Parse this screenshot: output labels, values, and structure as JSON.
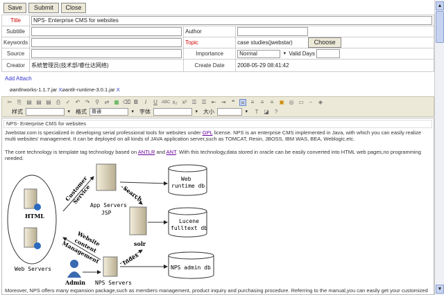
{
  "toolbar": {
    "save": "Save",
    "submit": "Submit",
    "close": "Close"
  },
  "form": {
    "title_label": "Title",
    "title_value": "NPS- Enterprise CMS for websites",
    "subtitle_label": "Subtitle",
    "subtitle_value": "",
    "author_label": "Author",
    "author_value": "",
    "keywords_label": "Keywords",
    "keywords_value": "",
    "topic_label": "Topic",
    "topic_value": "case studies(jwebstar)",
    "choose": "Choose",
    "source_label": "Source",
    "source_value": "",
    "importance_label": "Importance",
    "importance_value": "Normal",
    "valid_days_label": "Valid Days",
    "valid_days_value": "",
    "creator_label": "Creator",
    "creator_value": "系統管理员(技术部/睿仕达网络)",
    "create_date_label": "Create Date",
    "create_date_value": "2008-05-29 08:41:42"
  },
  "attach": {
    "add": "Add Attach",
    "files": [
      {
        "name": "antlrworks-1.1.7.jar",
        "remove": "X"
      },
      {
        "name": "antlr-runtime-3.0.1.jar",
        "remove": "X"
      }
    ]
  },
  "editor_toolbar": {
    "style_label": "样式",
    "style_value": "",
    "format_label": "格式",
    "format_value": "普通",
    "font_label": "字体",
    "font_value": "",
    "size_label": "大小",
    "size_value": ""
  },
  "content": {
    "heading": "NPS- Enterprise CMS for websites",
    "p1a": "Jwebstar.com is specialized in developing serial professional tools for websites under ",
    "gpl": "GPL",
    "p1b": " license. NPS is an enterprise CMS implemented in Java, with which you can easily realize multi websites' management. It can be deployed on all kinds of JAVA application server,such as TOMCAT, Resin, JBOSS, IBM WAS, BEA, Weblogic,etc.",
    "p2a": "The core technology is template tag technology based on ",
    "antlr": "ANTLR",
    "and": " and ",
    "ant": "ANT",
    "p2b": ". With this technology,data stored in oracle can be easily converted into HTML web pages,no programming needed.",
    "p3": "Moreover, NPS offers many expansion package,such as members management, product inquiry and purchasing procedure. Referring to the manual,you can easily get your customized",
    "diagram": {
      "html": "HTML",
      "web_servers": "Web Servers",
      "customer": "Customer",
      "service": "Service",
      "app_servers": "App Servers",
      "jsp": "JSP",
      "search": "Search",
      "solr": "solr",
      "website": "Website",
      "content": "content",
      "management": "Management",
      "index": "Index",
      "admin": "Admin",
      "nps_servers": "NPS Servers",
      "db1a": "Web",
      "db1b": "runtime db",
      "db2a": "Lucene",
      "db2b": "fulltext db",
      "db3": "NPS admin db"
    }
  }
}
